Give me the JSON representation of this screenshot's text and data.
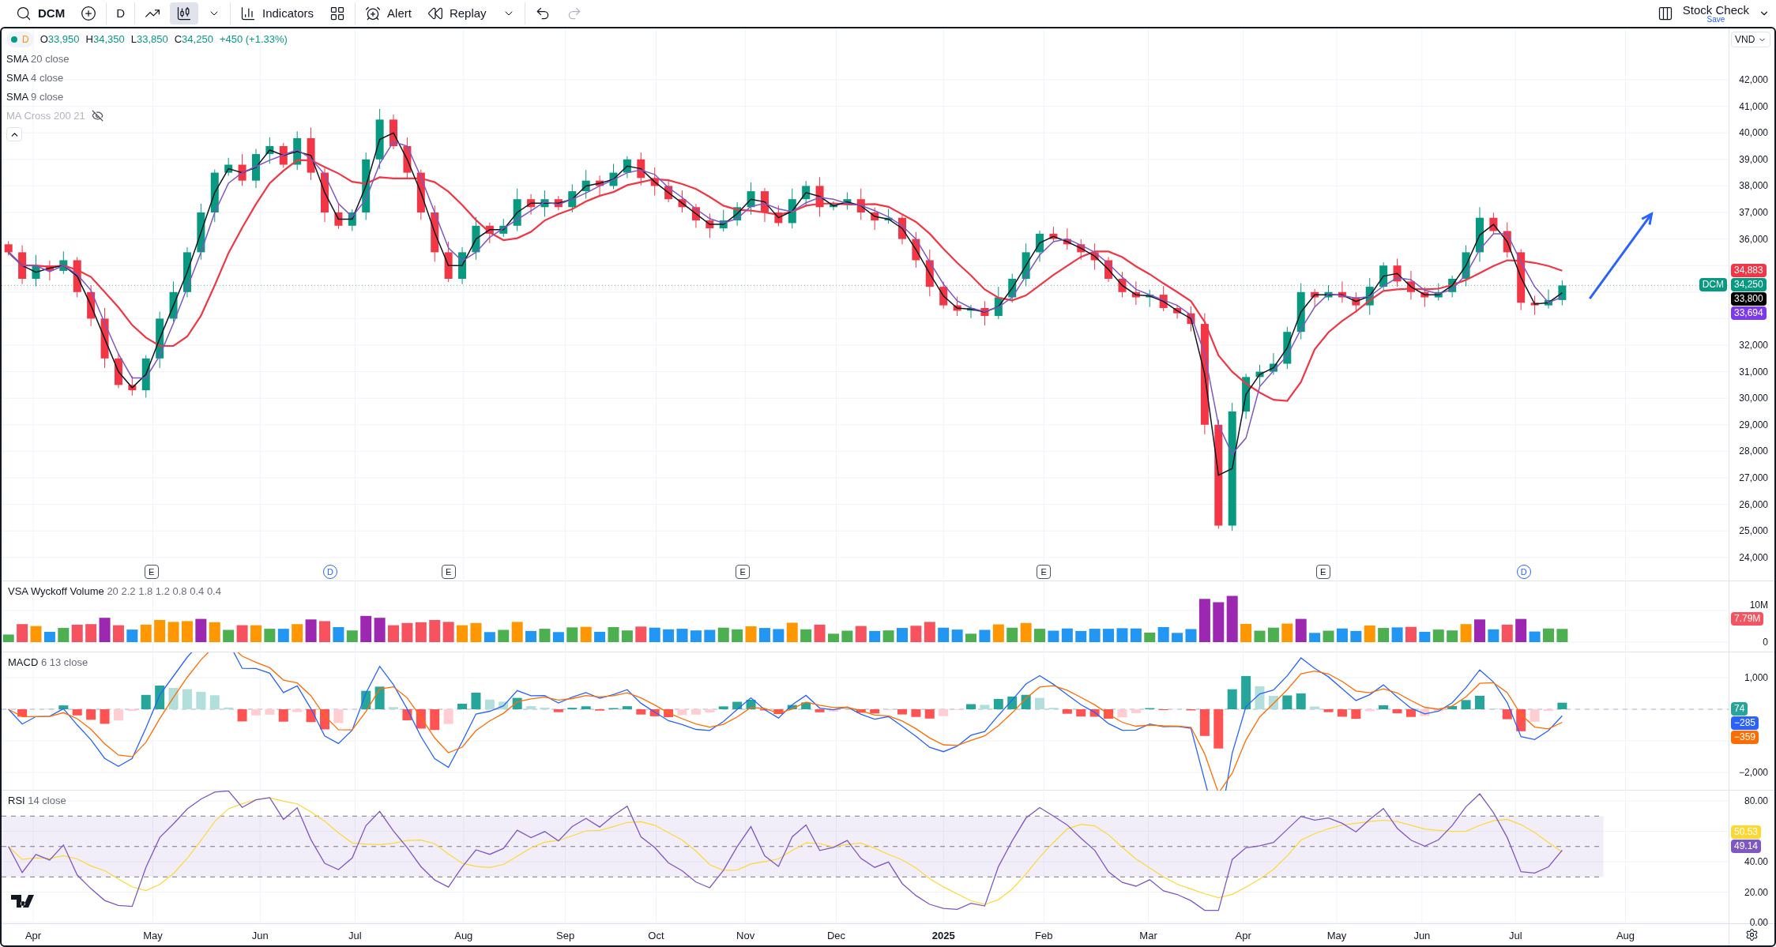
{
  "toolbar": {
    "groups": [
      [
        {
          "kind": "symbol",
          "label": "DCM",
          "selected": false,
          "disabled": false
        },
        {
          "kind": "add",
          "selected": false,
          "disabled": false
        }
      ],
      [
        {
          "kind": "interval",
          "label": "D",
          "selected": false,
          "disabled": false
        }
      ],
      [
        {
          "kind": "line",
          "selected": false,
          "disabled": false
        },
        {
          "kind": "candles",
          "selected": true,
          "disabled": false
        },
        {
          "kind": "dropdown",
          "selected": false,
          "disabled": false
        }
      ],
      [
        {
          "kind": "indicators",
          "label": "Indicators",
          "selected": false,
          "disabled": false
        },
        {
          "kind": "templates",
          "selected": false,
          "disabled": false
        }
      ],
      [
        {
          "kind": "alert",
          "label": "Alert",
          "selected": false,
          "disabled": false
        },
        {
          "kind": "replay",
          "label": "Replay",
          "selected": false,
          "disabled": false
        },
        {
          "kind": "dropdown",
          "selected": false,
          "disabled": false
        }
      ],
      [
        {
          "kind": "undo",
          "selected": false,
          "disabled": false
        },
        {
          "kind": "redo",
          "selected": false,
          "disabled": true
        }
      ]
    ],
    "layout_name": "Stock Check",
    "save_label": "Save"
  },
  "main_pane": {
    "status": {
      "color": "#089981",
      "interval": "D"
    },
    "ohlc": [
      {
        "key": "O",
        "value": "33,950"
      },
      {
        "key": "H",
        "value": "34,350"
      },
      {
        "key": "L",
        "value": "33,850"
      },
      {
        "key": "C",
        "value": "34,250"
      }
    ],
    "change": "+450 (+1.33%)",
    "legend": [
      {
        "name": "SMA",
        "params": "20 close",
        "color": "#f23645",
        "hidden": false
      },
      {
        "name": "SMA",
        "params": "4 close",
        "color": "#131722",
        "hidden": false
      },
      {
        "name": "SMA",
        "params": "9 close",
        "color": "#7e57c2",
        "hidden": false
      },
      {
        "name": "MA Cross",
        "params": "200 21",
        "hidden": true
      }
    ],
    "currency": "VND",
    "price_scale": [
      [
        "42,000",
        "41,000",
        "40,000",
        "39,000",
        "38,000",
        "37,000",
        "36,000"
      ],
      [
        "32,000",
        "31,000",
        "30,000",
        "29,000",
        "28,000",
        "27,000",
        "26,000",
        "25,000",
        "24,000"
      ]
    ],
    "price_labels": [
      {
        "text": "34,883",
        "color": "#f23645"
      },
      {
        "text": "34,250",
        "color": "#089981",
        "tag": "DCM"
      },
      {
        "text": "33,800",
        "color": "#000000"
      },
      {
        "text": "33,694",
        "color": "#7c3aed"
      }
    ],
    "drawings": [
      {
        "kind": "arrow",
        "color": "#2962ff"
      }
    ],
    "events": [
      {
        "kind": "earnings",
        "text": "E"
      },
      {
        "kind": "dividend",
        "text": "D"
      },
      {
        "kind": "earnings",
        "text": "E"
      },
      {
        "kind": "earnings",
        "text": "E"
      },
      {
        "kind": "earnings",
        "text": "E"
      },
      {
        "kind": "earnings",
        "text": "E"
      },
      {
        "kind": "dividend",
        "text": "D"
      }
    ]
  },
  "volume_pane": {
    "title": "VSA Wyckoff Volume",
    "params": "20 2.2 1.8 1.2 0.8 0.4 0.4",
    "scale": [
      [
        "10M",
        "0"
      ]
    ],
    "last_label": {
      "text": "7.79M",
      "color": "#f7525f"
    }
  },
  "macd_pane": {
    "title": "MACD",
    "params": "6 13 close",
    "scale": [
      [
        "1,000"
      ],
      [
        "−2,000"
      ]
    ],
    "labels": [
      {
        "text": "74",
        "color": "#26a69a"
      },
      {
        "text": "−285",
        "color": "#2962ff"
      },
      {
        "text": "−359",
        "color": "#ff6d00"
      }
    ]
  },
  "rsi_pane": {
    "title": "RSI",
    "params": "14 close",
    "scale": [
      [
        "80.00"
      ],
      [
        "40.00",
        "20.00",
        "0.00"
      ]
    ],
    "labels": [
      {
        "text": "50.53",
        "color": "#fdd835"
      },
      {
        "text": "49.14",
        "color": "#7e57c2"
      }
    ]
  },
  "time_axis": [
    {
      "text": "Apr",
      "kind": "month"
    },
    {
      "text": "May",
      "kind": "month"
    },
    {
      "text": "Jun",
      "kind": "month"
    },
    {
      "text": "Jul",
      "kind": "month"
    },
    {
      "text": "Aug",
      "kind": "month"
    },
    {
      "text": "Sep",
      "kind": "month"
    },
    {
      "text": "Oct",
      "kind": "month"
    },
    {
      "text": "Nov",
      "kind": "month"
    },
    {
      "text": "Dec",
      "kind": "month"
    },
    {
      "text": "2025",
      "kind": "year"
    },
    {
      "text": "Feb",
      "kind": "month"
    },
    {
      "text": "Mar",
      "kind": "month"
    },
    {
      "text": "Apr",
      "kind": "month"
    },
    {
      "text": "May",
      "kind": "month"
    },
    {
      "text": "Jun",
      "kind": "month"
    },
    {
      "text": "Jul",
      "kind": "month"
    },
    {
      "text": "Aug",
      "kind": "month"
    }
  ]
}
